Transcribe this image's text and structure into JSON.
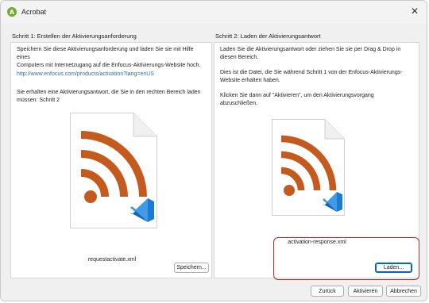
{
  "window": {
    "title": "Acrobat",
    "app_icon_glyph": "A",
    "close_glyph": "✕"
  },
  "step1": {
    "title": "Schritt 1: Erstellen der Aktivierungsanforderung",
    "p1_line1": "Speichern Sie diese Aktivierungsanforderung und laden Sie sie mit Hilfe eines",
    "p1_line2": "Computers mit Internetzugang auf die Enfocus-Aktivierungs-Website hoch.",
    "link": "http://www.enfocus.com/products/activation?lang=enUS",
    "p2_line1": "Sie erhalten eine Aktivierungsantwort, die Sie in den rechten Bereich laden",
    "p2_line2": "müssen: Schritt 2",
    "file_name": "requestactivate.xml",
    "save_label": "Speichern..."
  },
  "step2": {
    "title": "Schritt 2: Laden der Aktivierungsantwort",
    "p1_line1": "Laden Sie die Aktivierungsantwort oder ziehen Sie sie per Drag & Drop in",
    "p1_line2": "diesen Bereich.",
    "p2_line1": "Dies ist die Datei, die Sie während Schritt 1 von der Enfocus-Aktivierungs-",
    "p2_line2": "Website erhalten haben.",
    "p3_line1": "Klicken Sie dann auf \"Aktivieren\", um den Aktivierungsvorgang",
    "p3_line2": "abzuschließen.",
    "file_name": "activation-response.xml",
    "load_label": "Laden..."
  },
  "footer": {
    "back_label": "Zurück",
    "activate_label": "Aktivieren",
    "cancel_label": "Abbrechen"
  },
  "colors": {
    "rss_orange": "#c55a1e",
    "vscode_blue": "#1a7ad4",
    "highlight": "#b03030",
    "link": "#2a6fb0"
  },
  "icons": {
    "file_icon": "xml-file-icon",
    "rss": "rss-feed-icon",
    "vscode": "vscode-icon"
  }
}
